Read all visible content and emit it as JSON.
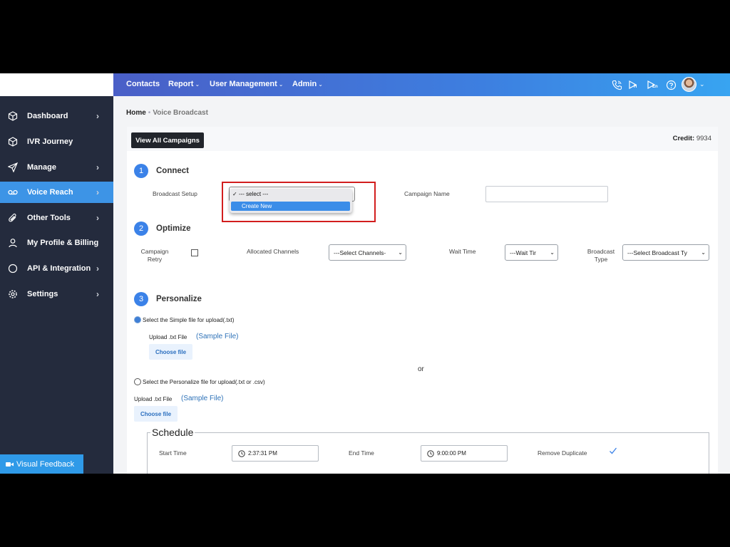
{
  "sidebar": {
    "items": [
      {
        "label": "Dashboard",
        "icon": "cube-icon",
        "chevron": "›"
      },
      {
        "label": "IVR Journey",
        "icon": "cube-icon",
        "chevron": ""
      },
      {
        "label": "Manage",
        "icon": "send-icon",
        "chevron": "›"
      },
      {
        "label": "Voice Reach",
        "icon": "voicemail-icon",
        "chevron": "›"
      },
      {
        "label": "Other Tools",
        "icon": "paperclip-icon",
        "chevron": "›"
      },
      {
        "label": "My Profile & Billing",
        "icon": "user-icon",
        "chevron": ""
      },
      {
        "label": "API & Integration",
        "icon": "circle-icon",
        "chevron": "›"
      },
      {
        "label": "Settings",
        "icon": "gear-icon",
        "chevron": "›"
      }
    ],
    "feedback_label": "Visual Feedback"
  },
  "topbar": {
    "contacts": "Contacts",
    "report": "Report",
    "user_management": "User Management",
    "admin": "Admin",
    "caret": "⌄",
    "icons": [
      "phone-icon",
      "play-h-icon",
      "play-en-icon",
      "help-icon"
    ],
    "icon_sub_h": "H",
    "icon_sub_en": "En"
  },
  "breadcrumb": {
    "home": "Home",
    "sep": "•",
    "current": "Voice Broadcast"
  },
  "card": {
    "view_all": "View All Campaigns",
    "credit_label": "Credit:",
    "credit_value": "9934"
  },
  "connect": {
    "num": "1",
    "title": "Connect",
    "broadcast_setup_label": "Broadcast Setup",
    "dropdown_options": [
      "--- select ---",
      "Create New"
    ],
    "checkmark": "✓",
    "campaign_name_label": "Campaign Name"
  },
  "optimize": {
    "num": "2",
    "title": "Optimize",
    "campaign_retry": "Campaign Retry",
    "allocated_channels": "Allocated Channels",
    "channels_value": "---Select Channels-",
    "wait_time": "Wait Time",
    "wait_value": "---Wait Tir",
    "broadcast_type": "Broadcast Type",
    "broadcast_type_value": "---Select Broadcast Ty",
    "arrow": "⌄"
  },
  "personalize": {
    "num": "3",
    "title": "Personalize",
    "simple_label": "Select the Simple file for upload(.txt)",
    "upload_label": "Upload .txt File",
    "sample": "(Sample File)",
    "choose": "Choose file",
    "or": "or",
    "personalize_label": "Select the Personalize file for upload(.txt or .csv)"
  },
  "schedule": {
    "title": "Schedule",
    "start_label": "Start Time",
    "start_value": "2:37:31 PM",
    "end_label": "End Time",
    "end_value": "9:00:00 PM",
    "remove_duplicate": "Remove Duplicate"
  },
  "colors": {
    "accent": "#3b82e8",
    "sidebar": "#242b3d",
    "highlight": "#d21e1e"
  }
}
